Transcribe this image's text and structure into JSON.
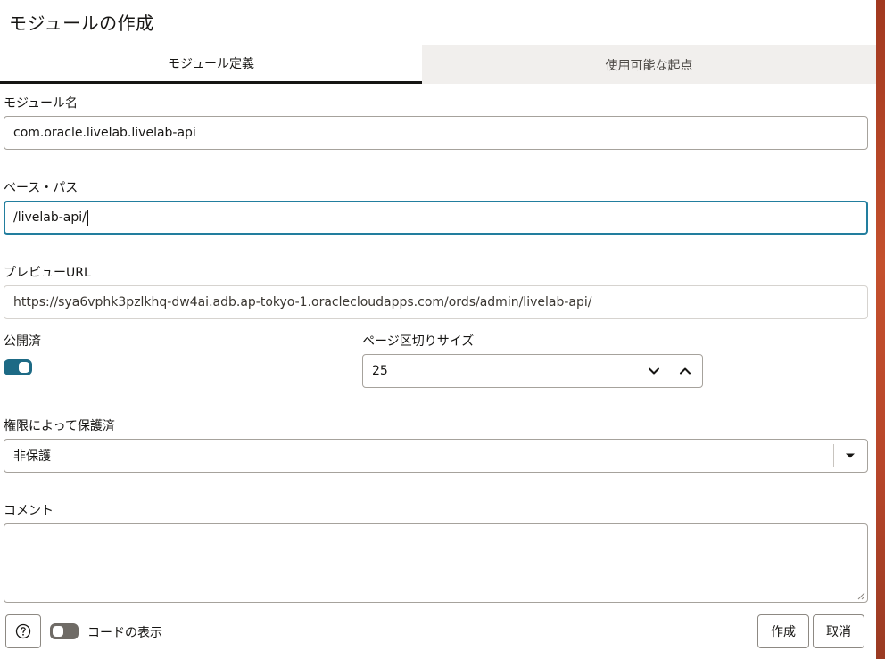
{
  "dialog": {
    "title": "モジュールの作成"
  },
  "tabs": [
    {
      "label": "モジュール定義",
      "active": true
    },
    {
      "label": "使用可能な起点",
      "active": false
    }
  ],
  "form": {
    "module_name": {
      "label": "モジュール名",
      "value": "com.oracle.livelab.livelab-api"
    },
    "base_path": {
      "label": "ベース・パス",
      "value": "/livelab-api/"
    },
    "preview_url": {
      "label": "プレビューURL",
      "value": "https://sya6vphk3pzlkhq-dw4ai.adb.ap-tokyo-1.oraclecloudapps.com/ords/admin/livelab-api/"
    },
    "published": {
      "label": "公開済",
      "on": true
    },
    "page_size": {
      "label": "ページ区切りサイズ",
      "value": "25"
    },
    "protected_by_privilege": {
      "label": "権限によって保護済",
      "value": "非保護"
    },
    "comment": {
      "label": "コメント",
      "value": ""
    }
  },
  "footer": {
    "help_icon": "question-circle-icon",
    "show_code_label": "コードの表示",
    "show_code_on": false,
    "create_label": "作成",
    "cancel_label": "取消"
  },
  "colors": {
    "accent": "#227e9e",
    "toggle_on": "#1d6a85",
    "tab_inactive_bg": "#f1efed"
  }
}
